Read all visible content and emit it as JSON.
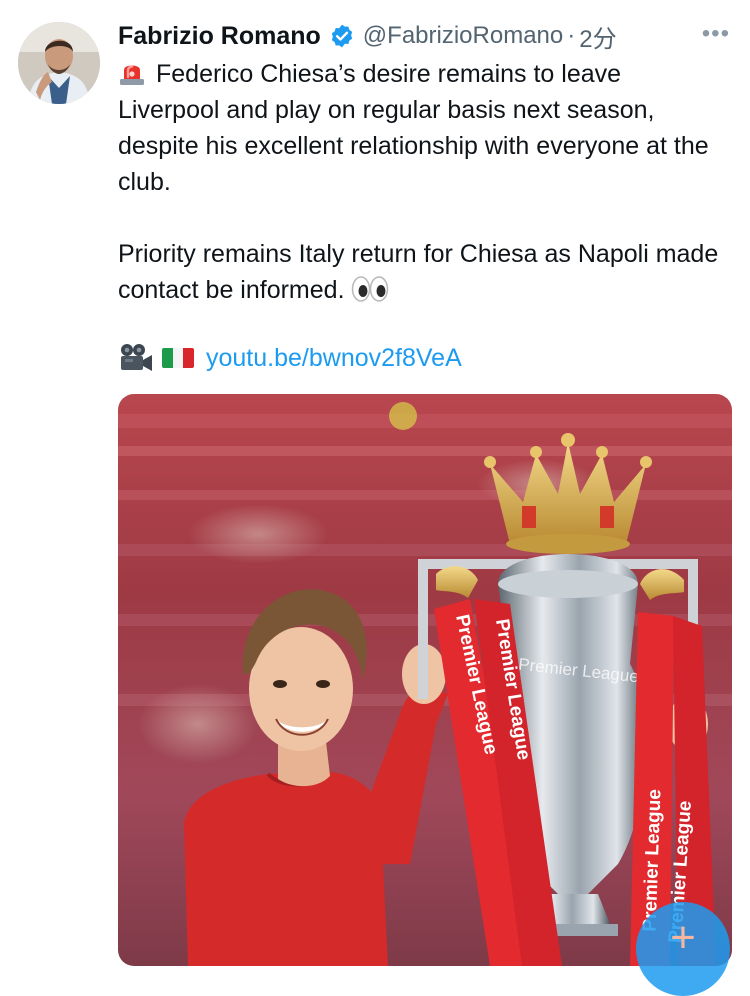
{
  "author": {
    "name": "Fabrizio Romano",
    "handle": "@FabrizioRomano",
    "separator": "·",
    "time": "2分",
    "more": "•••"
  },
  "tweet": {
    "paragraph1": "Federico Chiesa’s desire remains to leave Liverpool and play on regular basis next season, despite his excellent relationship with everyone at the club.",
    "paragraph2": "Priority remains Italy return for Chiesa as Napoli made contact be informed.",
    "link": "youtu.be/bwnov2f8VeA"
  },
  "media": {
    "ribbon_text": "Premier League",
    "trophy_text": "Premier League"
  },
  "compose": {
    "plus": "+"
  },
  "colors": {
    "link": "#1d9bf0",
    "secondary_text": "#536471",
    "verified": "#1d9bf0"
  },
  "icons": [
    "siren-emoji",
    "eyes-emoji",
    "movie-camera-emoji",
    "italy-flag-emoji",
    "verified-badge-icon",
    "more-icon",
    "compose-plus-icon"
  ]
}
